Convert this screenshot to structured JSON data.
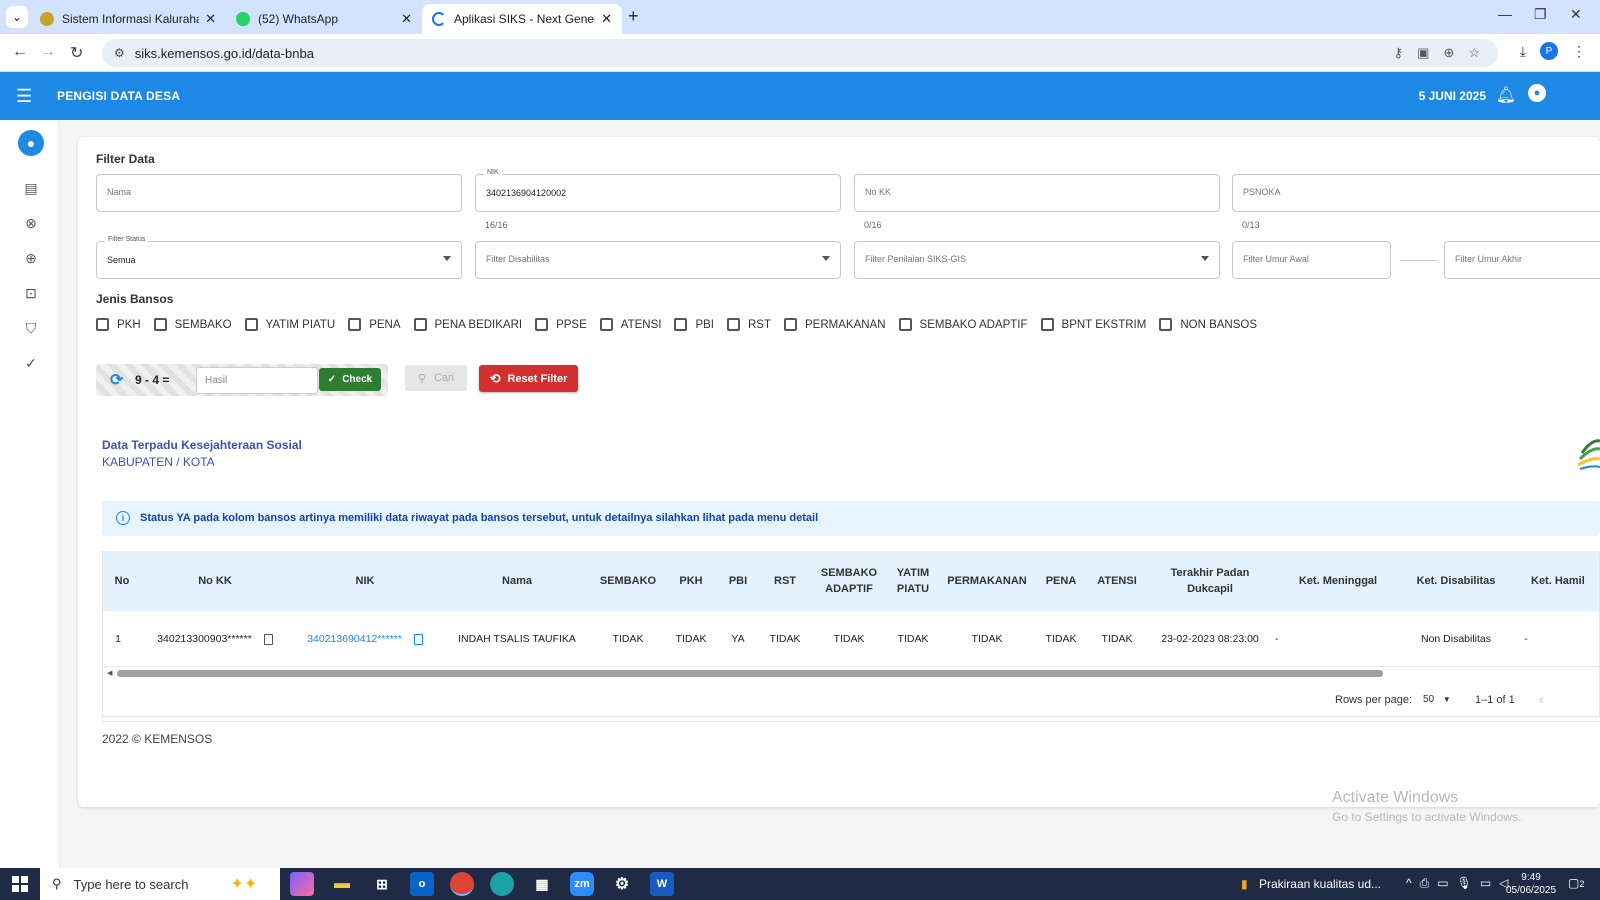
{
  "browser": {
    "tabs": [
      {
        "title": "Sistem Informasi Kaluraha Plered",
        "close": "✕"
      },
      {
        "title": "(52) WhatsApp",
        "close": "✕"
      },
      {
        "title": "Aplikasi SIKS - Next Generation",
        "close": "✕"
      }
    ],
    "new_tab": "+",
    "url": "siks.kemensos.go.id/data-bnba",
    "profile_initial": "P"
  },
  "app": {
    "title": "PENGISI DATA DESA",
    "date": "5 JUNI 2025"
  },
  "filter": {
    "title": "Filter Data",
    "nama": {
      "placeholder": "Nama"
    },
    "nik": {
      "label": "NIK",
      "value": "3402136904120002",
      "counter": "16/16"
    },
    "nokk": {
      "placeholder": "No KK",
      "counter": "0/16"
    },
    "psnoka": {
      "placeholder": "PSNOKA",
      "counter": "0/13"
    },
    "status": {
      "label": "Filter Status",
      "value": "Semua"
    },
    "disabilitas": {
      "placeholder": "Filter Disabilitas"
    },
    "penilaian": {
      "placeholder": "Filter Penilaian SIKS-GIS"
    },
    "umur_awal": {
      "placeholder": "Filter Umur Awal"
    },
    "umur_akhir": {
      "placeholder": "Filter Umur Akhir"
    }
  },
  "jenis_bansos": {
    "title": "Jenis Bansos",
    "items": [
      "PKH",
      "SEMBAKO",
      "YATIM PIATU",
      "PENA",
      "PENA BEDIKARI",
      "PPSE",
      "ATENSI",
      "PBI",
      "RST",
      "PERMAKANAN",
      "SEMBAKO ADAPTIF",
      "BPNT EKSTRIM",
      "NON BANSOS"
    ]
  },
  "captcha": {
    "question": "9 - 4 =",
    "input_placeholder": "Hasil",
    "check_label": "Check"
  },
  "actions": {
    "cari_label": "Cari",
    "reset_label": "Reset Filter"
  },
  "section": {
    "title": "Data Terpadu Kesejahteraan Sosial",
    "subtitle": "KABUPATEN / KOTA"
  },
  "alert": {
    "icon": "i",
    "text": "Status YA pada kolom bansos artinya memiliki data riwayat pada bansos tersebut, untuk detailnya silahkan lihat pada menu detail"
  },
  "table": {
    "headers": {
      "no": "No",
      "nokk": "No KK",
      "nik": "NIK",
      "nama": "Nama",
      "sembako": "SEMBAKO",
      "pkh": "PKH",
      "pbi": "PBI",
      "rst": "RST",
      "sembako_adaptif_1": "SEMBAKO",
      "sembako_adaptif_2": "ADAPTIF",
      "yatim_1": "YATIM",
      "yatim_2": "PIATU",
      "permakanan": "PERMAKANAN",
      "pena": "PENA",
      "atensi": "ATENSI",
      "padan_1": "Terakhir Padan",
      "padan_2": "Dukcapil",
      "meninggal": "Ket. Meninggal",
      "disabilitas": "Ket. Disabilitas",
      "hamil": "Ket. Hamil"
    },
    "rows": [
      {
        "no": "1",
        "nokk": "340213300903******",
        "nik": "340213690412******",
        "nama": "INDAH TSALIS TAUFIKA",
        "sembako": "TIDAK",
        "pkh": "TIDAK",
        "pbi": "YA",
        "rst": "TIDAK",
        "sembako_adaptif": "TIDAK",
        "yatim": "TIDAK",
        "permakanan": "TIDAK",
        "pena": "TIDAK",
        "atensi": "TIDAK",
        "padan": "23-02-2023 08:23:00",
        "meninggal": "-",
        "disabilitas": "Non Disabilitas",
        "hamil": "-"
      }
    ],
    "pagination": {
      "rows_per_page_label": "Rows per page:",
      "rows_per_page": "50",
      "range": "1–1 of 1"
    }
  },
  "footer": {
    "text": "2022 © KEMENSOS"
  },
  "watermark": {
    "line1": "Activate Windows",
    "line2": "Go to Settings to activate Windows."
  },
  "taskbar": {
    "search_placeholder": "Type here to search",
    "weather": "Prakiraan kualitas ud...",
    "time": "9:49",
    "date": "05/06/2025",
    "notif_count": "2"
  },
  "colors": {
    "app_header": "#1e88e5",
    "reset_button": "#d32f2f",
    "check_button": "#2e7d32",
    "table_header": "#e3f2fd",
    "alert_bg": "#e8f4fd"
  }
}
